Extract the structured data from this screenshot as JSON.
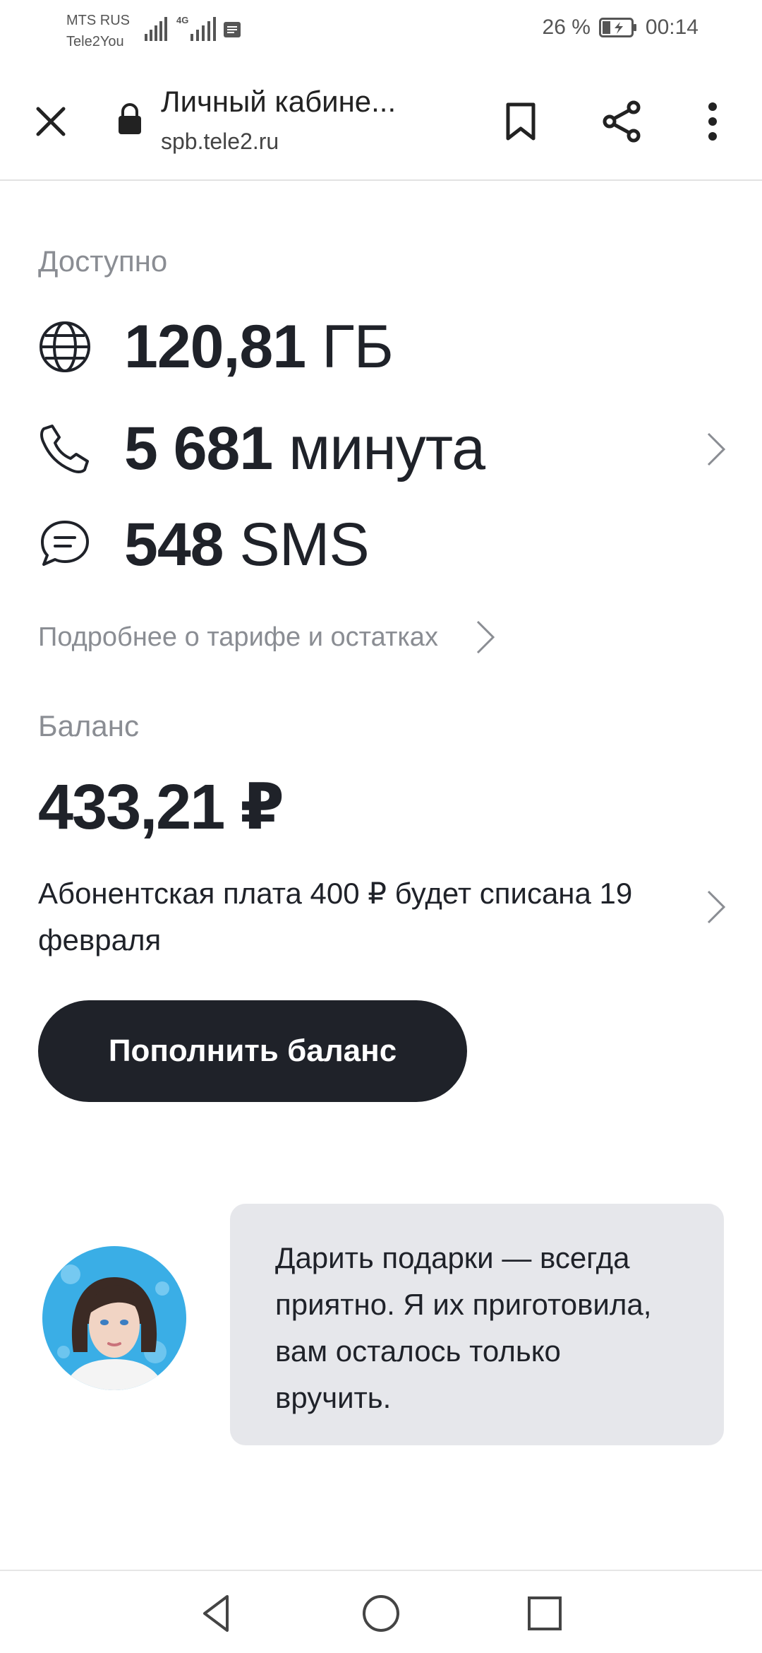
{
  "status_bar": {
    "carrier_1": "MTS RUS",
    "carrier_2": "Tele2You",
    "network_type": "4G",
    "battery": "26 %",
    "time": "00:14"
  },
  "browser": {
    "page_title": "Личный кабине...",
    "url": "spb.tele2.ru"
  },
  "available": {
    "label": "Доступно",
    "data_value": "120,81",
    "data_unit": "ГБ",
    "minutes_value": "5 681",
    "minutes_unit": "минута",
    "sms_value": "548",
    "sms_unit": "SMS",
    "details_link": "Подробнее о тарифе и остатках"
  },
  "balance": {
    "label": "Баланс",
    "amount": "433,21 ₽",
    "fee_notice": "Абонентская плата 400 ₽ будет списана 19 февраля",
    "topup_button": "Пополнить баланс"
  },
  "assistant": {
    "message": "Дарить подарки — всегда приятно. Я их приготовила, вам осталось только вручить."
  },
  "colors": {
    "dark": "#1f2229",
    "muted": "#8a8d93",
    "bubble": "#e6e7eb",
    "avatar_bg": "#3aaee6"
  },
  "icons": {
    "data": "globe-icon",
    "minutes": "phone-icon",
    "sms": "chat-bubble-icon"
  }
}
